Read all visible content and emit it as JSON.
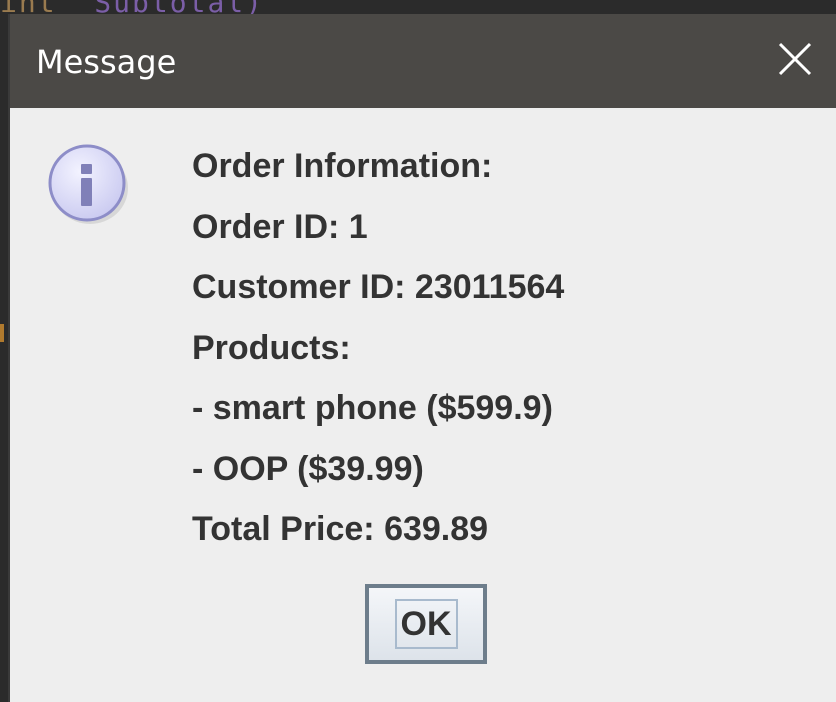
{
  "background": {
    "code_fragment_left": "int",
    "code_fragment_right": "Subtotal)"
  },
  "dialog": {
    "title": "Message",
    "close_icon": "close-x-icon",
    "info_icon": "information-icon",
    "lines": [
      "Order Information:",
      "Order ID: 1",
      "Customer ID: 23011564",
      "Products:",
      "- smart phone ($599.9)",
      "- OOP ($39.99)",
      "Total Price: 639.89"
    ],
    "ok_label": "OK"
  },
  "colors": {
    "titlebar": "#4b4946",
    "dialog_bg": "#eeeeee",
    "text": "#333333",
    "icon_fill": "#d9d9f6",
    "icon_stroke": "#8d8dc8"
  }
}
